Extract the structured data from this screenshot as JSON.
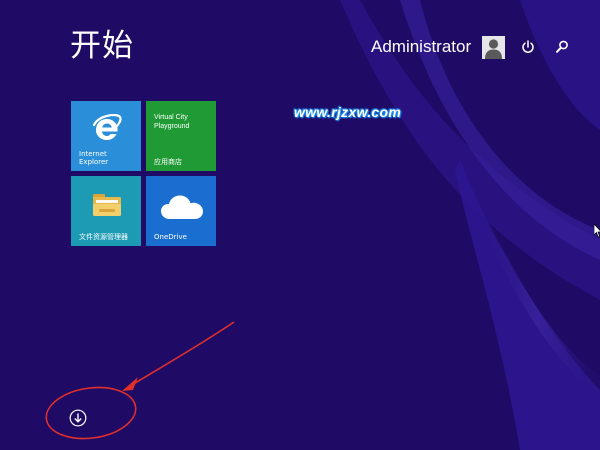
{
  "screen": {
    "title": "开始",
    "user": {
      "name": "Administrator"
    },
    "watermark": "www.rjzxw.com"
  },
  "tiles": [
    {
      "id": "ie",
      "label_line1": "Internet",
      "label_line2": "Explorer",
      "color": "#2a8fd8",
      "icon": "internet-explorer-icon"
    },
    {
      "id": "store",
      "title_line1": "Virtual City",
      "title_line2": "Playground",
      "label": "应用商店",
      "color": "#1f9a34"
    },
    {
      "id": "files",
      "label": "文件资源管理器",
      "color": "#1d9ab4",
      "icon": "folder-icon"
    },
    {
      "id": "onedrive",
      "label": "OneDrive",
      "color": "#1a6ed0",
      "icon": "cloud-icon"
    }
  ],
  "icons": {
    "power": "power-icon",
    "search": "search-icon",
    "avatar": "user-avatar-icon",
    "apps": "all-apps-down-arrow-icon"
  },
  "colors": {
    "background": "#1f0a66",
    "annotation": "#e0302a"
  }
}
